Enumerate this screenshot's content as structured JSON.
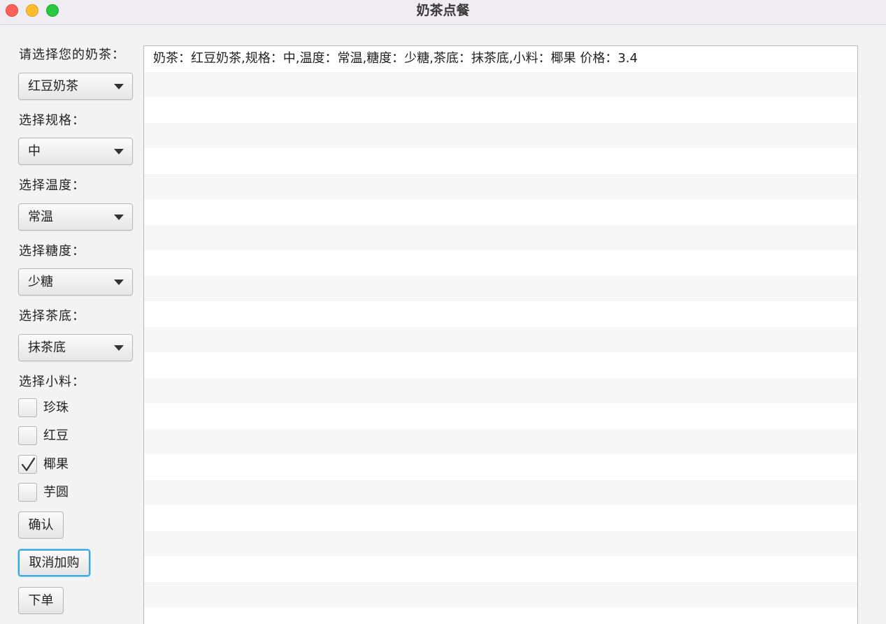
{
  "window": {
    "title": "奶茶点餐"
  },
  "form": {
    "tea_label": "请选择您的奶茶：",
    "tea_value": "红豆奶茶",
    "size_label": "选择规格：",
    "size_value": "中",
    "temp_label": "选择温度：",
    "temp_value": "常温",
    "sugar_label": "选择糖度：",
    "sugar_value": "少糖",
    "base_label": "选择茶底：",
    "base_value": "抹茶底",
    "toppings_label": "选择小料：",
    "toppings": [
      {
        "label": "珍珠",
        "checked": false
      },
      {
        "label": "红豆",
        "checked": false
      },
      {
        "label": "椰果",
        "checked": true
      },
      {
        "label": "芋圆",
        "checked": false
      }
    ]
  },
  "buttons": {
    "confirm": "确认",
    "cancel_add": "取消加购",
    "order": "下单"
  },
  "order_list": {
    "items": [
      "奶茶：红豆奶茶,规格：中,温度：常温,糖度：少糖,茶底：抹茶底,小料：椰果 价格：3.4"
    ]
  }
}
